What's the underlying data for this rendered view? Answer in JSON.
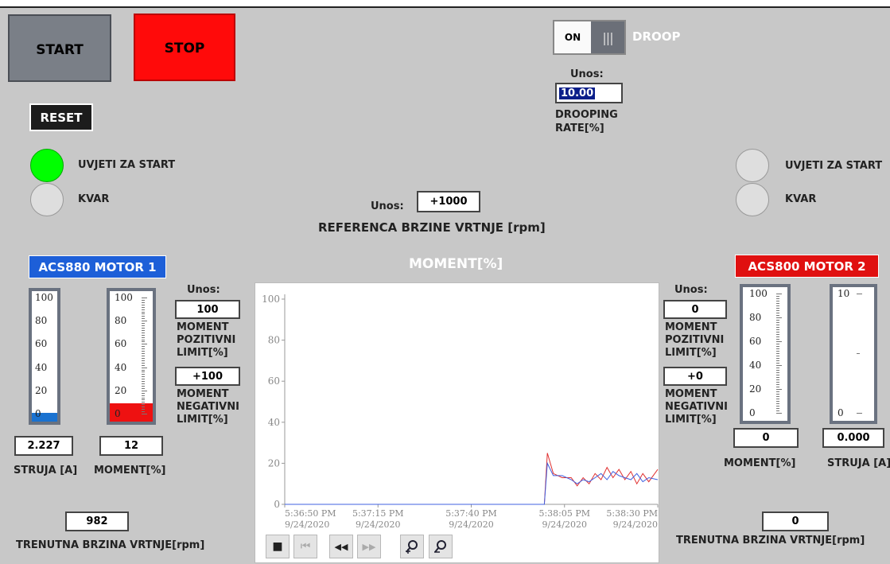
{
  "controls": {
    "start_label": "START",
    "stop_label": "STOP",
    "reset_label": "RESET"
  },
  "droop": {
    "toggle_state": "ON",
    "toggle_knob": "|||",
    "label": "DROOP",
    "input_caption": "Unos:",
    "rate_value": "10.00",
    "rate_label_line1": "DROOPING",
    "rate_label_line2": "RATE[%]"
  },
  "reference": {
    "input_caption": "Unos:",
    "value": "+1000",
    "label": "REFERENCA BRZINE VRTNJE [rpm]"
  },
  "status_left": {
    "start_label": "UVJETI ZA START",
    "fault_label": "KVAR",
    "start_lamp": "on",
    "fault_lamp": "off"
  },
  "status_right": {
    "start_label": "UVJETI ZA START",
    "fault_label": "KVAR",
    "start_lamp": "off",
    "fault_lamp": "off"
  },
  "motor1": {
    "title": "ACS880 MOTOR 1",
    "current_scale": [
      "100",
      "80",
      "60",
      "40",
      "20",
      "0"
    ],
    "current_value": "2.227",
    "current_label": "STRUJA [A]",
    "current_fill": 0.03,
    "moment_scale": [
      "100",
      "80",
      "60",
      "40",
      "20",
      "0"
    ],
    "moment_value": "12",
    "moment_label": "MOMENT[%]",
    "moment_fill": 0.12,
    "limit_caption": "Unos:",
    "pos_limit_value": "100",
    "pos_limit_label": [
      "MOMENT",
      "POZITIVNI",
      "LIMIT[%]"
    ],
    "neg_limit_value": "+100",
    "neg_limit_label": [
      "MOMENT",
      "NEGATIVNI",
      "LIMIT[%]"
    ],
    "speed_value": "982",
    "speed_label": "TRENUTNA BRZINA VRTNJE[rpm]"
  },
  "motor2": {
    "title": "ACS800 MOTOR 2",
    "moment_scale": [
      "100",
      "80",
      "60",
      "40",
      "20",
      "0"
    ],
    "moment_value": "0",
    "moment_label": "MOMENT[%]",
    "current_scale": [
      "10",
      "0"
    ],
    "current_value": "0.000",
    "current_label": "STRUJA [A]",
    "limit_caption": "Unos:",
    "pos_limit_value": "0",
    "pos_limit_label": [
      "MOMENT",
      "POZITIVNI",
      "LIMIT[%]"
    ],
    "neg_limit_value": "+0",
    "neg_limit_label": [
      "MOMENT",
      "NEGATIVNI",
      "LIMIT[%]"
    ],
    "speed_value": "0",
    "speed_label": "TRENUTNA BRZINA VRTNJE[rpm]"
  },
  "chart_data": {
    "type": "line",
    "title": "MOMENT[%]",
    "ylim": [
      0,
      100
    ],
    "y_ticks": [
      "0",
      "20",
      "40",
      "60",
      "80",
      "100"
    ],
    "x_ticks": [
      {
        "time": "5:36:50 PM",
        "date": "9/24/2020"
      },
      {
        "time": "5:37:15 PM",
        "date": "9/24/2020"
      },
      {
        "time": "5:37:40 PM",
        "date": "9/24/2020"
      },
      {
        "time": "5:38:05 PM",
        "date": "9/24/2020"
      },
      {
        "time": "5:38:30 PM",
        "date": "9/24/2020"
      }
    ],
    "x_range_seconds": [
      0,
      125
    ],
    "series": [
      {
        "color": "#e03030",
        "points": [
          [
            0,
            0
          ],
          [
            80,
            0
          ],
          [
            87,
            0
          ],
          [
            88,
            25
          ],
          [
            90,
            15
          ],
          [
            93,
            13
          ],
          [
            96,
            13
          ],
          [
            98,
            9
          ],
          [
            100,
            13
          ],
          [
            102,
            10
          ],
          [
            104,
            15
          ],
          [
            106,
            12
          ],
          [
            108,
            18
          ],
          [
            110,
            13
          ],
          [
            112,
            17
          ],
          [
            114,
            12
          ],
          [
            116,
            16
          ],
          [
            118,
            10
          ],
          [
            120,
            15
          ],
          [
            122,
            11
          ],
          [
            125,
            17
          ]
        ]
      },
      {
        "color": "#4060e0",
        "points": [
          [
            0,
            0
          ],
          [
            80,
            0
          ],
          [
            87,
            0
          ],
          [
            88,
            20
          ],
          [
            90,
            14
          ],
          [
            93,
            14
          ],
          [
            96,
            12
          ],
          [
            98,
            10
          ],
          [
            100,
            12
          ],
          [
            102,
            11
          ],
          [
            104,
            13
          ],
          [
            106,
            15
          ],
          [
            108,
            12
          ],
          [
            110,
            16
          ],
          [
            112,
            14
          ],
          [
            114,
            13
          ],
          [
            116,
            12
          ],
          [
            118,
            15
          ],
          [
            120,
            11
          ],
          [
            122,
            13
          ],
          [
            125,
            12
          ]
        ]
      }
    ]
  },
  "trend_toolbar": {
    "stop_icon": "■",
    "first_icon": "⏮",
    "back_icon": "◀◀",
    "forward_icon": "▶▶",
    "zoom_in_icon": "zoom-in",
    "zoom_out_icon": "zoom-out"
  }
}
